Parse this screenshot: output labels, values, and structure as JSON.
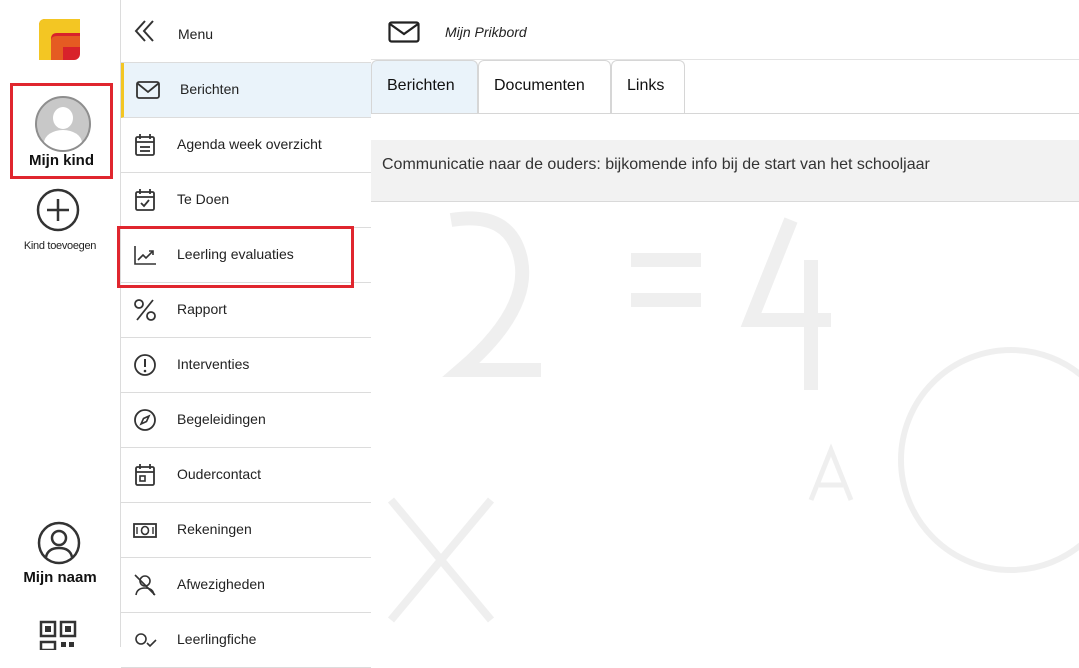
{
  "rail": {
    "child_label": "Mijn kind",
    "add_child_label": "Kind toevoegen",
    "user_label": "Mijn naam"
  },
  "menu": {
    "header_label": "Menu",
    "items": [
      {
        "label": "Berichten",
        "icon": "mail-icon"
      },
      {
        "label": "Agenda week overzicht",
        "icon": "calendar-icon"
      },
      {
        "label": "Te Doen",
        "icon": "calendar-check-icon"
      },
      {
        "label": "Leerling evaluaties",
        "icon": "trend-chart-icon"
      },
      {
        "label": "Rapport",
        "icon": "percent-icon"
      },
      {
        "label": "Interventies",
        "icon": "alert-circle-icon"
      },
      {
        "label": "Begeleidingen",
        "icon": "compass-icon"
      },
      {
        "label": "Oudercontact",
        "icon": "calendar-date-icon"
      },
      {
        "label": "Rekeningen",
        "icon": "banknote-icon"
      },
      {
        "label": "Afwezigheden",
        "icon": "user-off-icon"
      },
      {
        "label": "Leerlingfiche",
        "icon": "user-check-icon"
      }
    ],
    "active_index": 0
  },
  "main": {
    "title": "Mijn Prikbord",
    "tabs": [
      {
        "label": "Berichten",
        "active": true
      },
      {
        "label": "Documenten",
        "active": false
      },
      {
        "label": "Links",
        "active": false
      }
    ],
    "messages": [
      {
        "text": "Communicatie naar de ouders: bijkomende info bij de start van het schooljaar"
      }
    ]
  },
  "colors": {
    "highlight_red": "#e0262e",
    "active_bg": "#eaf3fa",
    "active_accent": "#f3c623",
    "logo_yellow": "#f3c623",
    "logo_red": "#d8222b"
  }
}
